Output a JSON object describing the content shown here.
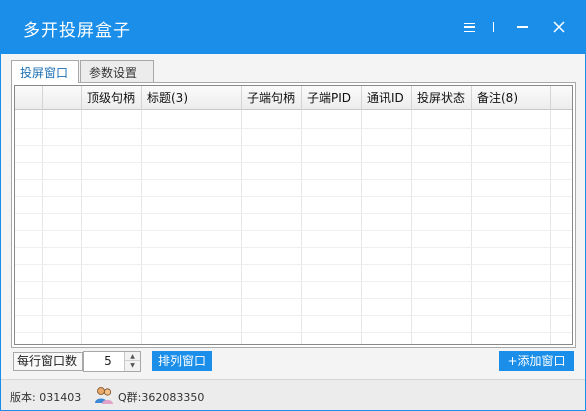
{
  "window": {
    "title": "多开投屏盒子"
  },
  "tabs": [
    {
      "label": "投屏窗口",
      "active": true
    },
    {
      "label": "参数设置",
      "active": false
    }
  ],
  "table": {
    "columns": [
      "",
      "",
      "顶级句柄",
      "标题(3)",
      "子端句柄",
      "子端PID",
      "通讯ID",
      "投屏状态",
      "备注(8)",
      ""
    ],
    "rows": []
  },
  "controls": {
    "per_row_label": "每行窗口数",
    "per_row_value": "5",
    "arrange_button": "排列窗口",
    "add_button": "+添加窗口"
  },
  "status": {
    "version": "版本: 031403",
    "qq_group": "Q群:362083350"
  },
  "colors": {
    "accent": "#1a8ee8"
  },
  "icons": {
    "menu": "hamburger-icon",
    "minimize": "minimize-icon",
    "close": "close-icon",
    "avatar": "users-icon"
  }
}
